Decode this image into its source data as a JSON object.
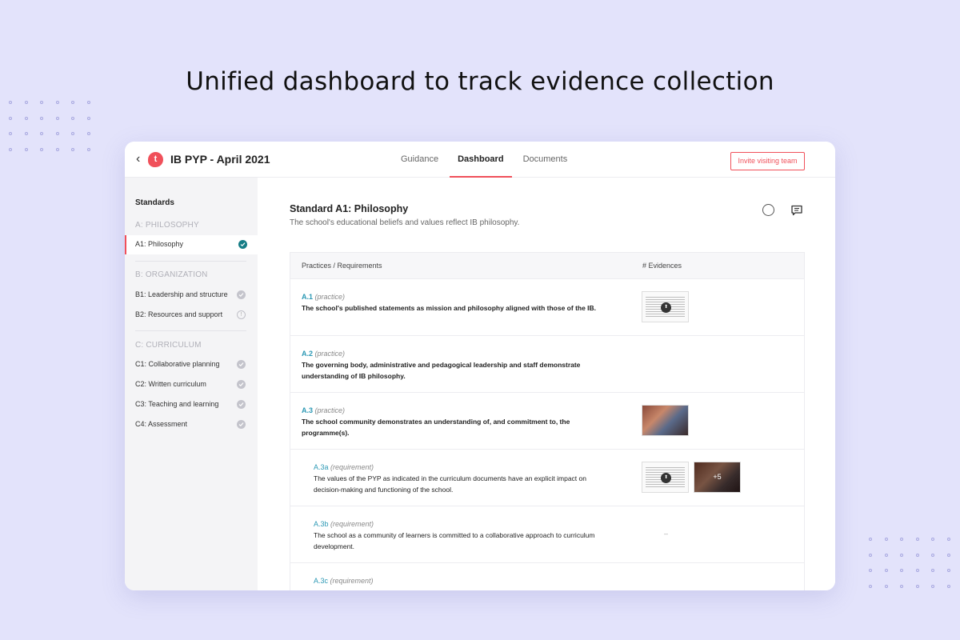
{
  "headline": "Unified dashboard to track evidence collection",
  "topbar": {
    "back_icon": "chevron-left-icon",
    "logo_letter": "t",
    "title": "IB PYP - April 2021",
    "tabs": [
      {
        "label": "Guidance",
        "active": false
      },
      {
        "label": "Dashboard",
        "active": true
      },
      {
        "label": "Documents",
        "active": false
      }
    ],
    "invite_label": "Invite visiting team"
  },
  "sidebar": {
    "title": "Standards",
    "sections": [
      {
        "label": "A: PHILOSOPHY",
        "items": [
          {
            "label": "A1: Philosophy",
            "status": "done",
            "active": true
          }
        ]
      },
      {
        "label": "B: ORGANIZATION",
        "items": [
          {
            "label": "B1: Leadership and structure",
            "status": "check"
          },
          {
            "label": "B2: Resources and support",
            "status": "info"
          }
        ]
      },
      {
        "label": "C: CURRICULUM",
        "items": [
          {
            "label": "C1: Collaborative planning",
            "status": "check"
          },
          {
            "label": "C2: Written curriculum",
            "status": "check"
          },
          {
            "label": "C3: Teaching and learning",
            "status": "check"
          },
          {
            "label": "C4: Assessment",
            "status": "check"
          }
        ]
      }
    ]
  },
  "main": {
    "title": "Standard A1: Philosophy",
    "subtitle": "The school's educational beliefs and values reflect IB philosophy.",
    "table": {
      "col_practices": "Practices / Requirements",
      "col_evidences": "# Evidences",
      "rows": [
        {
          "code": "A.1",
          "kind": "(practice)",
          "text": "The school's published statements as mission and philosophy aligned with those of the IB."
        },
        {
          "code": "A.2",
          "kind": "(practice)",
          "text": "The governing body, administrative and pedagogical leadership and staff demonstrate understanding of IB philosophy."
        },
        {
          "code": "A.3",
          "kind": "(practice)",
          "text": "The school community demonstrates an understanding of, and commitment to, the programme(s)."
        },
        {
          "code": "A.3a",
          "kind": "(requirement)",
          "text": "The values of the PYP as indicated in the curriculum documents have an explicit impact on decision-making and functioning of the school.",
          "more": "+5"
        },
        {
          "code": "A.3b",
          "kind": "(requirement)",
          "text": "The school as a community of learners is committed to a collaborative approach to curriculum development.",
          "empty": "–"
        },
        {
          "code": "A.3c",
          "kind": "(requirement)",
          "text": ""
        }
      ]
    }
  }
}
